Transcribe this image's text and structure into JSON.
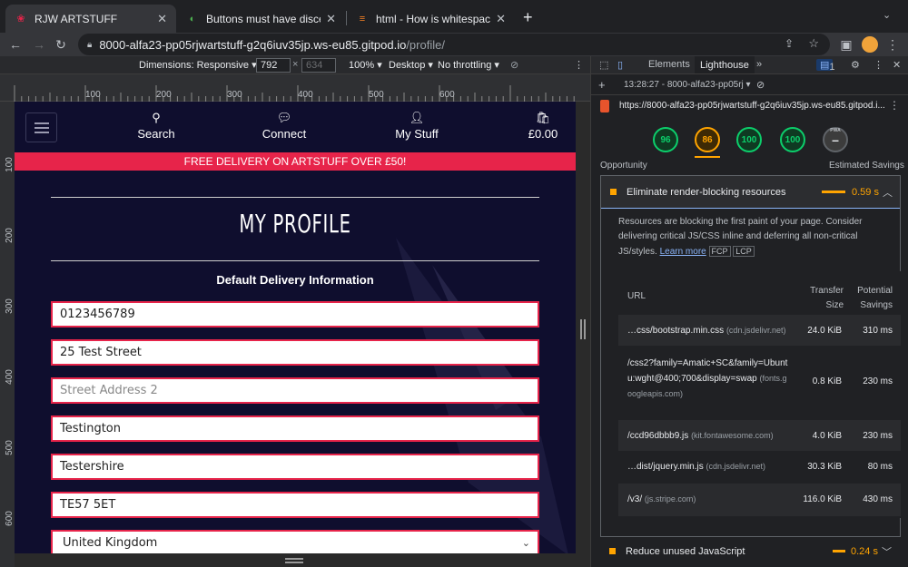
{
  "browser": {
    "tabs": [
      {
        "title": "RJW ARTSTUFF",
        "active": true
      },
      {
        "title": "Buttons must have discernible",
        "active": false
      },
      {
        "title": "html - How is whitespace in an",
        "active": false
      }
    ],
    "new_tab": "+",
    "url_host": "8000-alfa23-pp05rjwartstuff-g2q6iuv35jp.ws-eu85.gitpod.io",
    "url_path": "/profile/"
  },
  "device_toolbar": {
    "dimensions_label": "Dimensions: Responsive",
    "width_value": "792",
    "height_value": "634",
    "zoom": "100%",
    "device_type": "Desktop",
    "throttling": "No throttling"
  },
  "rulers": {
    "top_ticks": [
      "100",
      "200",
      "300",
      "400",
      "500",
      "600"
    ],
    "left_ticks": [
      "100",
      "200",
      "300",
      "400",
      "500",
      "600"
    ]
  },
  "site": {
    "nav": [
      {
        "label": "Search",
        "icon": "search-icon"
      },
      {
        "label": "Connect",
        "icon": "comments-icon"
      },
      {
        "label": "My Stuff",
        "icon": "user-icon"
      },
      {
        "label": "£0.00",
        "icon": "shopping-bag-icon"
      }
    ],
    "banner": "FREE DELIVERY ON ARTSTUFF OVER £50!",
    "page_title": "MY PROFILE",
    "section_title": "Default Delivery Information",
    "fields": [
      {
        "name": "phone",
        "value": "0123456789",
        "placeholder": false
      },
      {
        "name": "street-address-1",
        "value": "25 Test Street",
        "placeholder": false
      },
      {
        "name": "street-address-2",
        "value": "Street Address 2",
        "placeholder": true
      },
      {
        "name": "town",
        "value": "Testington",
        "placeholder": false
      },
      {
        "name": "county",
        "value": "Testershire",
        "placeholder": false
      },
      {
        "name": "postcode",
        "value": "TE57 5ET",
        "placeholder": false
      }
    ],
    "country": "United Kingdom",
    "colors": {
      "navy": "#0f0e2e",
      "accent": "#e7244a"
    }
  },
  "devtools": {
    "tabs": [
      "Elements",
      "Lighthouse"
    ],
    "active_tab": "Lighthouse",
    "issues_count": "1",
    "report_time": "13:28:27 - 8000-alfa23-pp05rj",
    "report_url": "https://8000-alfa23-pp05rjwartstuff-g2q6iuv35jp.ws-eu85.gitpod.i...",
    "scores": [
      {
        "value": "96",
        "color": "#0cce6b"
      },
      {
        "value": "86",
        "color": "#ffa400"
      },
      {
        "value": "100",
        "color": "#0cce6b"
      },
      {
        "value": "100",
        "color": "#0cce6b"
      }
    ],
    "pwa_label": "PWA",
    "opportunity_label": "Opportunity",
    "savings_label": "Estimated Savings",
    "audit_title": "Eliminate render-blocking resources",
    "audit_savings": "0.59 s",
    "audit_desc": "Resources are blocking the first paint of your page. Consider delivering critical JS/CSS inline and deferring all non-critical JS/styles.",
    "learn_more": "Learn more",
    "badges": [
      "FCP",
      "LCP"
    ],
    "table_headers": {
      "url": "URL",
      "transfer": "Transfer Size",
      "savings": "Potential Savings"
    },
    "rows": [
      {
        "url": "…css/bootstrap.min.css",
        "host": "(cdn.jsdelivr.net)",
        "size": "24.0 KiB",
        "savings": "310 ms"
      },
      {
        "url": "/css2?family=Amatic+SC&family=Ubuntu:wght@400;700&display=swap",
        "host": "(fonts.googleapis.com)",
        "size": "0.8 KiB",
        "savings": "230 ms"
      },
      {
        "url": "/ccd96dbbb9.js",
        "host": "(kit.fontawesome.com)",
        "size": "4.0 KiB",
        "savings": "230 ms"
      },
      {
        "url": "…dist/jquery.min.js",
        "host": "(cdn.jsdelivr.net)",
        "size": "30.3 KiB",
        "savings": "80 ms"
      },
      {
        "url": "/v3/",
        "host": "(js.stripe.com)",
        "size": "116.0 KiB",
        "savings": "430 ms"
      }
    ],
    "next_audit_title": "Reduce unused JavaScript",
    "next_audit_savings": "0.24 s"
  }
}
